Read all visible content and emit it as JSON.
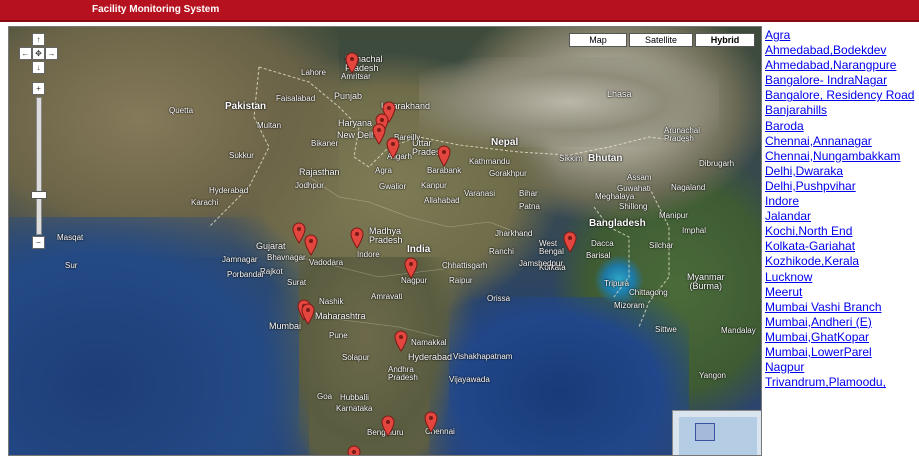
{
  "app": {
    "title": "Facility Monitoring System"
  },
  "map": {
    "type_buttons": {
      "map": "Map",
      "satellite": "Satellite",
      "hybrid": "Hybrid"
    },
    "active_type": "Hybrid",
    "nav": {
      "up": "↑",
      "left": "←",
      "center": "✥",
      "right": "→",
      "down": "↓",
      "zoom_in": "+",
      "zoom_out": "−"
    },
    "labels": {
      "pakistan": "Pakistan",
      "india": "India",
      "nepal": "Nepal",
      "bhutan": "Bhutan",
      "bangladesh": "Bangladesh",
      "myanmar": "Myanmar\n(Burma)",
      "lhasa": "Lhasa",
      "himachal": "Himachal\nPradesh",
      "uttarakhand": "Uttarakhand",
      "haryana": "Haryana",
      "newdelhi": "New Delhi",
      "uttarpradesh": "Uttar\nPradesh",
      "punjab": "Punjab",
      "rajasthan": "Rajasthan",
      "gujarat": "Gujarat",
      "madhyapradesh": "Madhya\nPradesh",
      "maharashtra": "Maharashtra",
      "mumbai": "Mumbai",
      "pune": "Pune",
      "hyderabad": "Hyderabad",
      "andhrapradesh": "Andhra\nPradesh",
      "karnataka": "Karnataka",
      "bengaluru": "Bengaluru",
      "chennai": "Chennai",
      "goa": "Goa",
      "kolkata": "Kolkata",
      "westbengal": "West\nBengal",
      "jharkhand": "Jharkhand",
      "chhattisgarh": "Chhattisgarh",
      "orissa": "Orissa",
      "bihar": "Bihar",
      "assam": "Assam",
      "nagaland": "Nagaland",
      "manipur": "Manipur",
      "tripura": "Tripura",
      "mizoram": "Mizoram",
      "dacca": "Dacca",
      "meghalaya": "Meghalaya",
      "arunachal": "Arunachal\nPradesh",
      "sikkim": "Sikkim",
      "karachi": "Karachi",
      "lahore": "Lahore",
      "amritsar": "Amritsar",
      "agra": "Agra",
      "kanpur": "Kanpur",
      "lucknow": "Lucknow",
      "indore": "Indore",
      "nagpur": "Nagpur",
      "surat": "Surat",
      "vadodara": "Vadodara",
      "rajkot": "Rajkot",
      "jamnagar": "Jamnagar",
      "vishakhapatnam": "Vishakhapatnam",
      "vijayawada": "Vijayawada",
      "nashik": "Nashik",
      "solapur": "Solapur",
      "hubballi": "Hubballi",
      "mangaluru": "Mangaluru",
      "kathmandu": "Kathmandu",
      "patna": "Patna",
      "allahabad": "Allahabad",
      "varanasi": "Varanasi",
      "gwalior": "Gwalior",
      "jodhpur": "Jodhpur",
      "bikaner": "Bikaner",
      "masqat": "Masqat",
      "sur": "Sur",
      "porbandar": "Porbandar",
      "bhavnagar": "Bhavnagar",
      "amravati": "Amravati",
      "raipur": "Raipur",
      "ranchi": "Ranchi",
      "jamshedpur": "Jamshedpur",
      "barasat": "Barisal",
      "chittagong": "Chittagong",
      "silchar": "Silchar",
      "imphal": "Imphal",
      "dibrugarh": "Dibrugarh",
      "guwahati": "Guwahati",
      "shillong": "Shillong",
      "gorakhpur": "Gorakhpur",
      "barabanki": "Barabank",
      "bareilly": "Bareilly",
      "aligarh": "Aligarh",
      "quetta": "Quetta",
      "multan": "Multan",
      "faisalabad": "Faisalabad",
      "hyderabad_pk": "Hyderabad",
      "sukkur": "Sukkur",
      "mandalay": "Mandalay",
      "yangon": "Yangon",
      "sittwe": "Sittwe",
      "namakkal": "Namakkal"
    }
  },
  "locations": [
    "Agra",
    "Ahmedabad,Bodekdev",
    "Ahmedabad,Narangpure",
    "Bangalore- IndraNagar",
    "Bangalore, Residency Road",
    "Banjarahills",
    "Baroda",
    "Chennai,Annanagar",
    "Chennai,Nungambakkam",
    "Delhi,Dwaraka",
    "Delhi,Pushpvihar",
    "Indore",
    "Jalandar",
    "Kochi,North End",
    "Kolkata-Gariahat",
    "Kozhikode,Kerala",
    "Lucknow",
    "Meerut",
    "Mumbai Vashi Branch",
    "Mumbai,Andheri (E)",
    "Mumbai,GhatKopar",
    "Mumbai,LowerParel",
    "Nagpur",
    "Trivandrum,Plamoodu,"
  ],
  "colors": {
    "header": "#b5111e",
    "link": "#0000ee",
    "marker": "#e3463f"
  }
}
